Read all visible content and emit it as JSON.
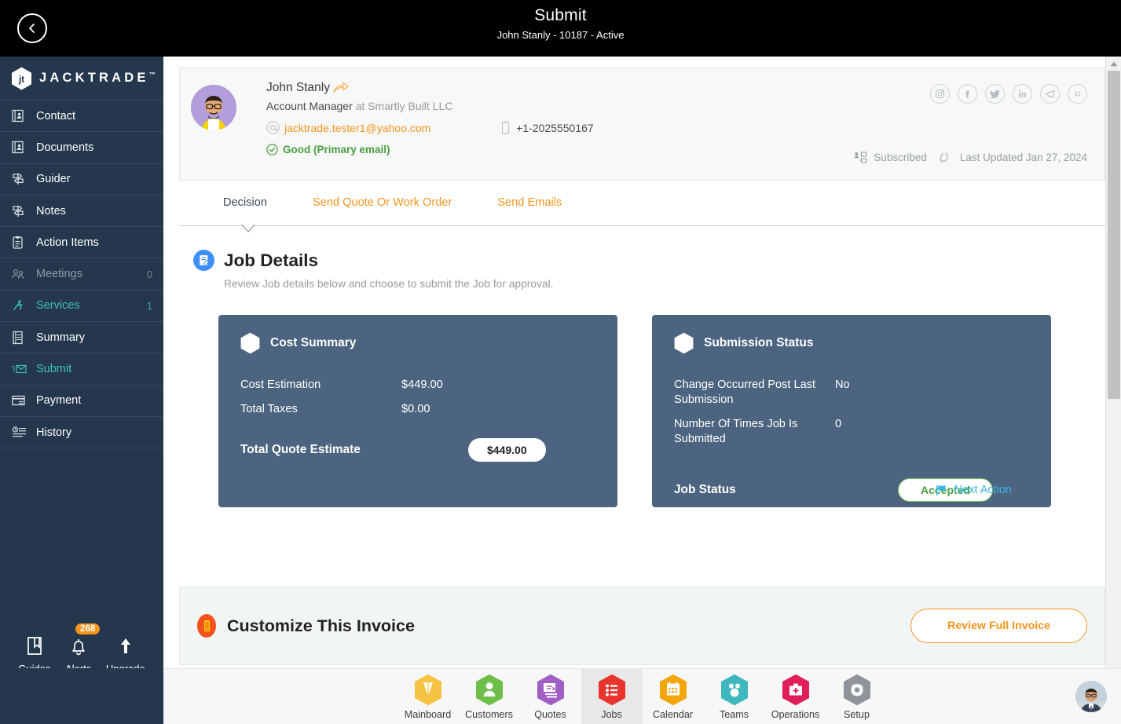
{
  "header": {
    "back_icon": "chevron-left-icon",
    "title": "Submit",
    "subtitle": "John Stanly - 10187 - Active"
  },
  "sidebar": {
    "brand": "JACKTRADE",
    "brand_tm": "™",
    "items": [
      {
        "label": "Contact",
        "icon": "contact-card-icon",
        "count": "",
        "state": "normal"
      },
      {
        "label": "Documents",
        "icon": "documents-icon",
        "count": "",
        "state": "normal"
      },
      {
        "label": "Guider",
        "icon": "signpost-icon",
        "count": "",
        "state": "normal"
      },
      {
        "label": "Notes",
        "icon": "signpost-icon",
        "count": "",
        "state": "normal"
      },
      {
        "label": "Action Items",
        "icon": "clipboard-icon",
        "count": "",
        "state": "normal"
      },
      {
        "label": "Meetings",
        "icon": "meetings-icon",
        "count": "0",
        "state": "dim"
      },
      {
        "label": "Services",
        "icon": "services-icon",
        "count": "1",
        "state": "active"
      },
      {
        "label": "Summary",
        "icon": "summary-icon",
        "count": "",
        "state": "normal"
      },
      {
        "label": "Submit",
        "icon": "submit-mail-icon",
        "count": "",
        "state": "active"
      },
      {
        "label": "Payment",
        "icon": "payment-card-icon",
        "count": "",
        "state": "normal"
      },
      {
        "label": "History",
        "icon": "history-icon",
        "count": "",
        "state": "normal"
      }
    ],
    "quick": [
      {
        "label": "Guides",
        "icon": "book-icon",
        "badge": ""
      },
      {
        "label": "Alerts",
        "icon": "bell-icon",
        "badge": "268"
      },
      {
        "label": "Upgrade",
        "icon": "arrow-up-icon",
        "badge": ""
      }
    ],
    "hex_shortcuts": [
      {
        "icon": "person-hex-icon"
      },
      {
        "icon": "dollar-hex-icon"
      },
      {
        "icon": "money-transfer-hex-icon"
      },
      {
        "icon": "workflow-hex-icon"
      }
    ]
  },
  "contact": {
    "avatar_icon": "user-avatar",
    "name": "John Stanly",
    "share_icon": "share-arrow-icon",
    "role": "Account Manager",
    "role_connector": " at ",
    "company": "Smartly Built LLC",
    "email_icon": "at-sign-icon",
    "email": "jacktrade.tester1@yahoo.com",
    "phone_icon": "mobile-phone-icon",
    "phone": "+1-2025550167",
    "quality_icon": "check-circle-icon",
    "quality": "Good (Primary email)",
    "socials": [
      {
        "name": "instagram-icon",
        "glyph": "□"
      },
      {
        "name": "facebook-icon",
        "glyph": "f"
      },
      {
        "name": "twitter-icon",
        "glyph": "✓"
      },
      {
        "name": "linkedin-icon",
        "glyph": "in"
      },
      {
        "name": "telegram-icon",
        "glyph": "➤"
      },
      {
        "name": "more-apps-icon",
        "glyph": "∷"
      }
    ],
    "subscribed_icon": "subscribed-icon",
    "subscribed": "Subscribed",
    "refresh_icon": "refresh-icon",
    "last_updated": "Last Updated Jan 27, 2024"
  },
  "tabs": [
    {
      "label": "Decision",
      "active": true
    },
    {
      "label": "Send Quote Or Work Order",
      "active": false
    },
    {
      "label": "Send Emails",
      "active": false
    }
  ],
  "job_details": {
    "icon": "job-details-icon",
    "title": "Job Details",
    "subtitle": "Review Job details below and choose to submit the Job for approval."
  },
  "cost_summary": {
    "hex_icon": "hexagon-icon",
    "title": "Cost Summary",
    "rows": [
      {
        "label": "Cost Estimation",
        "value": "$449.00"
      },
      {
        "label": "Total Taxes",
        "value": "$0.00"
      }
    ],
    "total_label": "Total Quote Estimate",
    "total_value": "$449.00"
  },
  "submission_status": {
    "hex_icon": "hexagon-icon",
    "title": "Submission Status",
    "rows": [
      {
        "label": "Change Occurred Post Last Submission",
        "value": "No"
      },
      {
        "label": "Number Of Times Job Is Submitted",
        "value": "0"
      }
    ],
    "job_status_label": "Job Status",
    "job_status_value": "Accepted",
    "next_action_icon": "flag-icon",
    "next_action_label": "Next Action"
  },
  "invoice": {
    "icon": "invoice-icon",
    "title": "Customize This Invoice",
    "button_label": "Review Full Invoice"
  },
  "bottom_nav": {
    "items": [
      {
        "label": "Mainboard",
        "icon": "mainboard-hex-icon",
        "color": "#f5c242",
        "active": false
      },
      {
        "label": "Customers",
        "icon": "customers-hex-icon",
        "color": "#6fbe4a",
        "active": false
      },
      {
        "label": "Quotes",
        "icon": "quotes-hex-icon",
        "color": "#a05fc4",
        "active": false
      },
      {
        "label": "Jobs",
        "icon": "jobs-hex-icon",
        "color": "#e8342c",
        "active": true
      },
      {
        "label": "Calendar",
        "icon": "calendar-hex-icon",
        "color": "#f2a60c",
        "active": false
      },
      {
        "label": "Teams",
        "icon": "teams-hex-icon",
        "color": "#3fb8bd",
        "active": false
      },
      {
        "label": "Operations",
        "icon": "operations-hex-icon",
        "color": "#e01e5a",
        "active": false
      },
      {
        "label": "Setup",
        "icon": "setup-hex-icon",
        "color": "#8e9499",
        "active": false
      }
    ],
    "avatar_icon": "profile-avatar"
  },
  "colors": {
    "brand_orange": "#f7941e",
    "sidebar_bg": "#24374c",
    "card_bg": "#4c6480",
    "accent_teal": "#3fc0bd",
    "link_blue": "#39b8e8",
    "status_green": "#4a9e3f"
  }
}
